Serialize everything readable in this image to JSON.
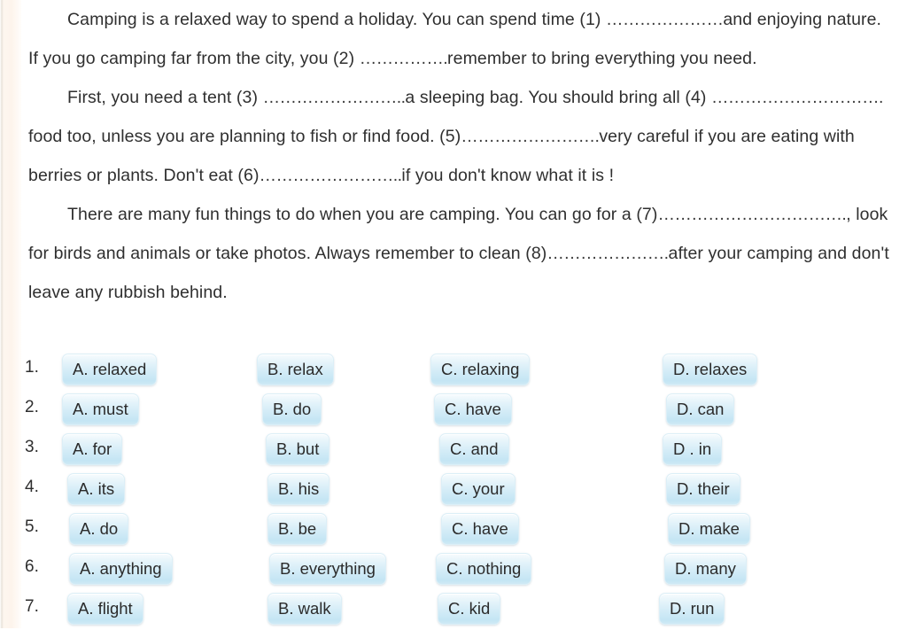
{
  "page": {
    "passage": {
      "paragraphs": [
        {
          "id": "p1",
          "indent": true,
          "segments": [
            {
              "type": "text",
              "value": "Camping is a relaxed way to spend a holiday. You can spend time (1) "
            },
            {
              "type": "dots",
              "value": "…………………"
            },
            {
              "type": "text",
              "value": "and enjoying nature. If you go camping far from the city, you (2) "
            },
            {
              "type": "dots",
              "value": "……………."
            },
            {
              "type": "text",
              "value": "remember to bring everything you need."
            }
          ]
        },
        {
          "id": "p2",
          "indent": true,
          "segments": [
            {
              "type": "text",
              "value": "First, you need a tent (3) "
            },
            {
              "type": "dots",
              "value": "…………………….."
            },
            {
              "type": "text",
              "value": "a sleeping bag. You should bring all (4) "
            },
            {
              "type": "dots",
              "value": "…………………………."
            },
            {
              "type": "text",
              "value": " food too, unless you are planning to fish or find food. (5)"
            },
            {
              "type": "dots",
              "value": "……………………."
            },
            {
              "type": "text",
              "value": "very careful if you are eating with berries or plants. Don't eat (6)"
            },
            {
              "type": "dots",
              "value": "…………………….."
            },
            {
              "type": "text",
              "value": "if you don't know what it is !"
            }
          ]
        },
        {
          "id": "p3",
          "indent": true,
          "segments": [
            {
              "type": "text",
              "value": "There are many fun things to do when you are camping. You can go for a (7)"
            },
            {
              "type": "dots",
              "value": "……………………………."
            },
            {
              "type": "text",
              "value": ", look for birds and animals or take photos. Always remember to clean (8)"
            },
            {
              "type": "dots",
              "value": "…………………."
            },
            {
              "type": "text",
              "value": "after your camping and don't leave any rubbish behind."
            }
          ]
        }
      ]
    },
    "questions": [
      {
        "number": "1.",
        "options": [
          {
            "key": "A",
            "label": "A. relaxed"
          },
          {
            "key": "B",
            "label": "B. relax"
          },
          {
            "key": "C",
            "label": "C. relaxing"
          },
          {
            "key": "D",
            "label": "D. relaxes"
          }
        ]
      },
      {
        "number": "2.",
        "options": [
          {
            "key": "A",
            "label": "A. must"
          },
          {
            "key": "B",
            "label": "B. do"
          },
          {
            "key": "C",
            "label": "C. have"
          },
          {
            "key": "D",
            "label": "D. can"
          }
        ]
      },
      {
        "number": "3.",
        "options": [
          {
            "key": "A",
            "label": "A. for"
          },
          {
            "key": "B",
            "label": "B. but"
          },
          {
            "key": "C",
            "label": "C. and"
          },
          {
            "key": "D",
            "label": "D . in"
          }
        ]
      },
      {
        "number": "4.",
        "options": [
          {
            "key": "A",
            "label": "A. its"
          },
          {
            "key": "B",
            "label": "B. his"
          },
          {
            "key": "C",
            "label": "C. your"
          },
          {
            "key": "D",
            "label": "D. their"
          }
        ]
      },
      {
        "number": "5.",
        "options": [
          {
            "key": "A",
            "label": "A. do"
          },
          {
            "key": "B",
            "label": "B. be"
          },
          {
            "key": "C",
            "label": "C. have"
          },
          {
            "key": "D",
            "label": "D. make"
          }
        ]
      },
      {
        "number": "6.",
        "options": [
          {
            "key": "A",
            "label": "A. anything"
          },
          {
            "key": "B",
            "label": "B. everything"
          },
          {
            "key": "C",
            "label": "C. nothing"
          },
          {
            "key": "D",
            "label": "D. many"
          }
        ]
      },
      {
        "number": "7.",
        "options": [
          {
            "key": "A",
            "label": "A. flight"
          },
          {
            "key": "B",
            "label": "B. walk"
          },
          {
            "key": "C",
            "label": "C. kid"
          },
          {
            "key": "D",
            "label": "D. run"
          }
        ]
      }
    ],
    "colors": {
      "text": "#2f2f2f",
      "option_fill_top": "#f7fcfe",
      "option_fill_bottom": "#c4e5f4",
      "page_edge": "#fdf4ec"
    }
  }
}
